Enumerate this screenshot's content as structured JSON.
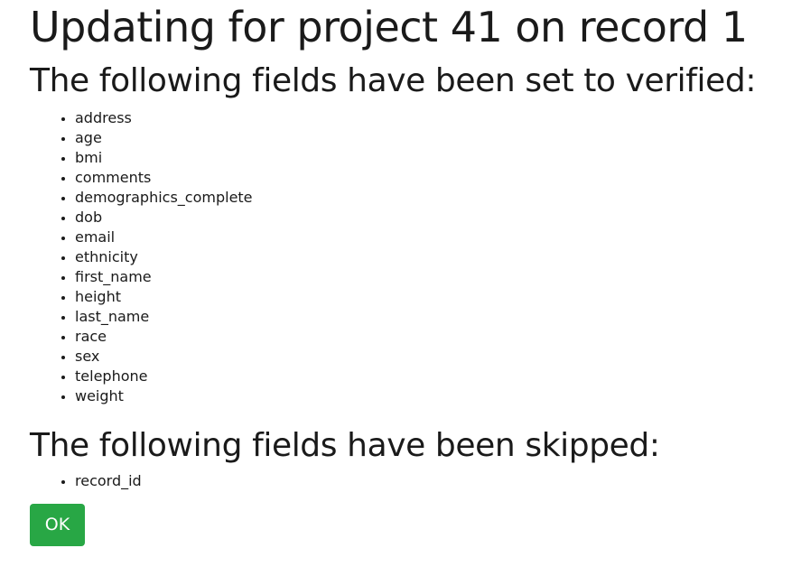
{
  "title": "Updating for project 41 on record 1",
  "verified": {
    "heading": "The following fields have been set to verified:",
    "fields": [
      "address",
      "age",
      "bmi",
      "comments",
      "demographics_complete",
      "dob",
      "email",
      "ethnicity",
      "first_name",
      "height",
      "last_name",
      "race",
      "sex",
      "telephone",
      "weight"
    ]
  },
  "skipped": {
    "heading": "The following fields have been skipped:",
    "fields": [
      "record_id"
    ]
  },
  "actions": {
    "ok_label": "OK",
    "ok_color": "#28a745"
  }
}
